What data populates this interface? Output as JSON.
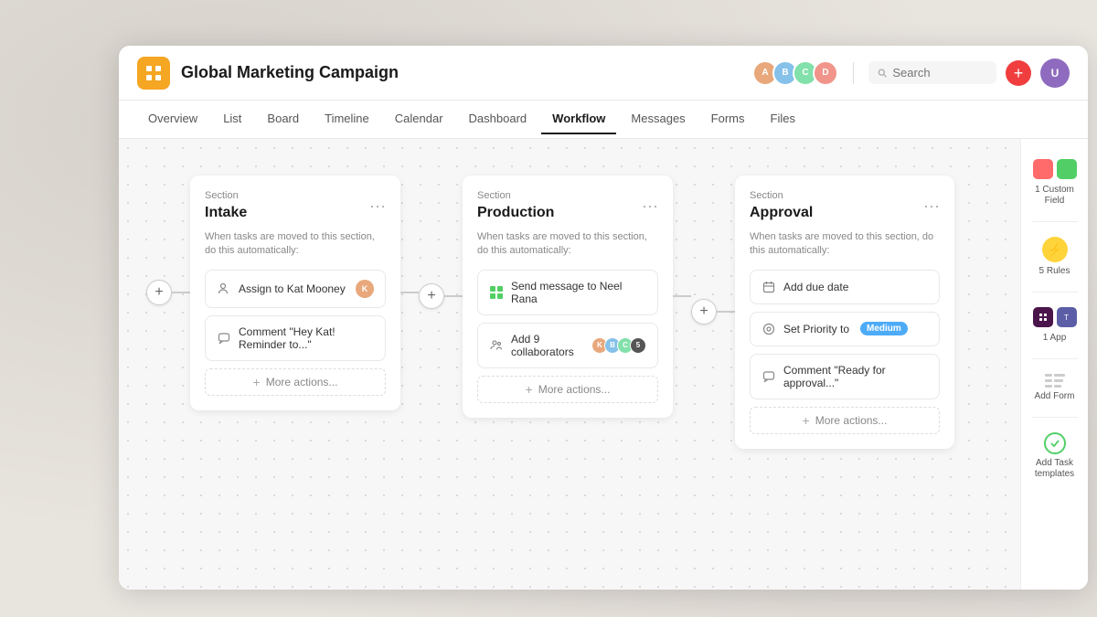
{
  "app": {
    "title": "Global Marketing Campaign",
    "icon": "grid-icon"
  },
  "nav": {
    "items": [
      {
        "label": "Overview",
        "active": false
      },
      {
        "label": "List",
        "active": false
      },
      {
        "label": "Board",
        "active": false
      },
      {
        "label": "Timeline",
        "active": false
      },
      {
        "label": "Calendar",
        "active": false
      },
      {
        "label": "Dashboard",
        "active": false
      },
      {
        "label": "Workflow",
        "active": true
      },
      {
        "label": "Messages",
        "active": false
      },
      {
        "label": "Forms",
        "active": false
      },
      {
        "label": "Files",
        "active": false
      }
    ]
  },
  "search": {
    "placeholder": "Search"
  },
  "sections": [
    {
      "label": "Section",
      "name": "Intake",
      "description": "When tasks are moved to this section, do this automatically:",
      "actions": [
        {
          "type": "assign",
          "text": "Assign to Kat Mooney",
          "hasAvatar": true
        },
        {
          "type": "comment",
          "text": "Comment \"Hey Kat! Reminder to...\""
        }
      ],
      "more": "More actions..."
    },
    {
      "label": "Section",
      "name": "Production",
      "description": "When tasks are moved to this section, do this automatically:",
      "actions": [
        {
          "type": "message",
          "text": "Send message to Neel Rana"
        },
        {
          "type": "collaborators",
          "text": "Add 9 collaborators",
          "count": "5"
        }
      ],
      "more": "More actions..."
    },
    {
      "label": "Section",
      "name": "Approval",
      "description": "When tasks are moved to this section, do this automatically:",
      "actions": [
        {
          "type": "date",
          "text": "Add due date"
        },
        {
          "type": "priority",
          "text": "Set Priority to",
          "badge": "Medium"
        },
        {
          "type": "comment",
          "text": "Comment \"Ready for approval...\""
        }
      ],
      "more": "More actions..."
    }
  ],
  "sidebar": {
    "items": [
      {
        "label": "1 Custom\nField",
        "type": "custom-field"
      },
      {
        "label": "5 Rules",
        "type": "rules"
      },
      {
        "label": "1 App",
        "type": "app"
      },
      {
        "label": "Add Form",
        "type": "form"
      },
      {
        "label": "Add Task\ntemplates",
        "type": "task-templates"
      }
    ]
  }
}
